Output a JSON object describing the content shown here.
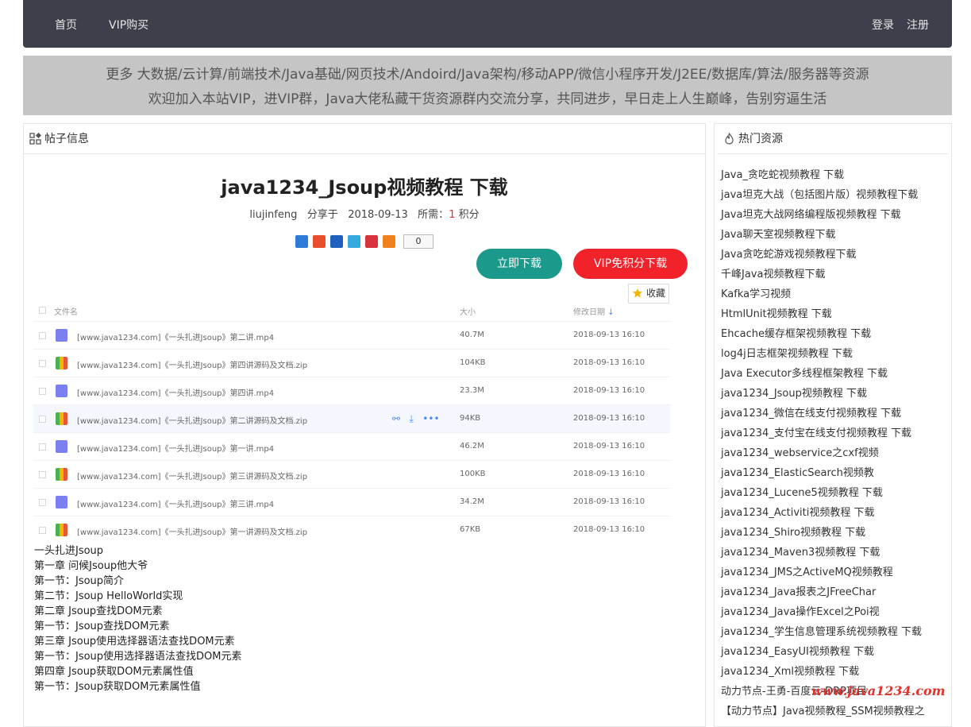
{
  "nav": {
    "home": "首页",
    "vip": "VIP购买",
    "login": "登录",
    "register": "注册"
  },
  "banner": {
    "line1": "更多 大数据/云计算/前端技术/Java基础/网页技术/Andoird/Java架构/移动APP/微信小程序开发/J2EE/数据库/算法/服务器等资源",
    "line2": "欢迎加入本站VIP，进VIP群，Java大佬私藏干货资源群内交流分享，共同进步，早日走上人生巅峰，告别穷逼生活"
  },
  "post": {
    "section_title": "帖子信息",
    "title": "java1234_Jsoup视频教程 下载",
    "author": "liujinfeng",
    "shared_label": "分享于",
    "date": "2018-09-13",
    "cost_label": "所需：",
    "cost": "1",
    "cost_unit": "积分",
    "share_count": "0",
    "download_btn": "立即下载",
    "vip_btn": "VIP免积分下载",
    "favorite": "收藏"
  },
  "files": {
    "headers": {
      "name": "文件名",
      "size": "大小",
      "date": "修改日期"
    },
    "rows": [
      {
        "name": "[www.java1234.com]《一头扎进Jsoup》第二讲.mp4",
        "size": "40.7M",
        "date": "2018-09-13 16:10",
        "type": "video"
      },
      {
        "name": "[www.java1234.com]《一头扎进Jsoup》第四讲源码及文档.zip",
        "size": "104KB",
        "date": "2018-09-13 16:10",
        "type": "zip"
      },
      {
        "name": "[www.java1234.com]《一头扎进Jsoup》第四讲.mp4",
        "size": "23.3M",
        "date": "2018-09-13 16:10",
        "type": "video"
      },
      {
        "name": "[www.java1234.com]《一头扎进Jsoup》第二讲源码及文档.zip",
        "size": "94KB",
        "date": "2018-09-13 16:10",
        "type": "zip"
      },
      {
        "name": "[www.java1234.com]《一头扎进Jsoup》第一讲.mp4",
        "size": "46.2M",
        "date": "2018-09-13 16:10",
        "type": "video"
      },
      {
        "name": "[www.java1234.com]《一头扎进Jsoup》第三讲源码及文档.zip",
        "size": "100KB",
        "date": "2018-09-13 16:10",
        "type": "zip"
      },
      {
        "name": "[www.java1234.com]《一头扎进Jsoup》第三讲.mp4",
        "size": "34.2M",
        "date": "2018-09-13 16:10",
        "type": "video"
      },
      {
        "name": "[www.java1234.com]《一头扎进Jsoup》第一讲源码及文档.zip",
        "size": "67KB",
        "date": "2018-09-13 16:10",
        "type": "zip"
      }
    ]
  },
  "description": [
    "一头扎进Jsoup",
    "第一章 问候Jsoup他大爷",
    "第一节：Jsoup简介",
    "第二节：Jsoup HelloWorld实现",
    "第二章 Jsoup查找DOM元素",
    "第一节：Jsoup查找DOM元素",
    "第三章 Jsoup使用选择器语法查找DOM元素",
    "第一节：Jsoup使用选择器语法查找DOM元素",
    "第四章 Jsoup获取DOM元素属性值",
    "第一节：Jsoup获取DOM元素属性值"
  ],
  "hot": {
    "title": "热门资源",
    "items": [
      "Java_贪吃蛇视频教程 下载",
      "java坦克大战（包括图片版）视频教程下载",
      "Java坦克大战网络编程版视频教程 下载",
      "Java聊天室视频教程下载",
      "Java贪吃蛇游戏视频教程下载",
      "千峰Java视频教程下载",
      "Kafka学习视频",
      "HtmlUnit视频教程 下载",
      "Ehcache缓存框架视频教程 下载",
      "log4j日志框架视频教程 下载",
      "Java Executor多线程框架教程 下载",
      "java1234_Jsoup视频教程 下载",
      "java1234_微信在线支付视频教程 下载",
      "java1234_支付宝在线支付视频教程 下载",
      "java1234_webservice之cxf视频",
      "java1234_ElasticSearch视频教",
      "java1234_Lucene5视频教程 下载",
      "java1234_Activiti视频教程 下载",
      "java1234_Shiro视频教程 下载",
      "java1234_Maven3视频教程 下载",
      "java1234_JMS之ActiveMQ视频教程",
      "java1234_Java报表之JFreeChar",
      "java1234_Java操作Excel之Poi视",
      "java1234_学生信息管理系统视频教程 下载",
      "java1234_EasyUI视频教程 下载",
      "java1234_Xml视频教程 下载",
      "动力节点-王勇-百度云-DRP项目",
      "【动力节点】Java视频教程_SSM视频教程之"
    ]
  },
  "watermark": "www.java1234.com",
  "colors": {
    "navbar": "#3d3f4a",
    "banner": "#c5c5c5",
    "download_btn": "#1b9a8c",
    "vip_btn": "#f2222a",
    "highlight": "#e0332e"
  }
}
